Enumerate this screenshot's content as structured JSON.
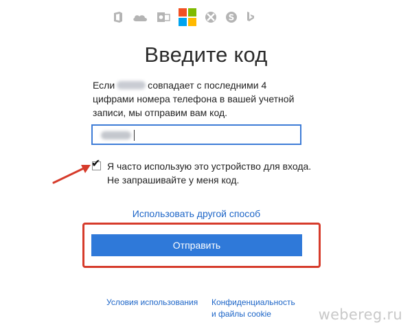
{
  "header": {
    "product_icons": [
      "office-icon",
      "onedrive-icon",
      "outlook-icon",
      "microsoft-logo",
      "xbox-icon",
      "skype-icon",
      "bing-icon"
    ]
  },
  "page": {
    "title": "Введите код",
    "description_part1": "Если",
    "description_part2": "совпадает с последними 4 цифрами номера телефона в вашей учетной записи, мы отправим вам код."
  },
  "remember": {
    "checked": true,
    "label": "Я часто использую это устройство для входа. Не запрашивайте у меня код."
  },
  "links": {
    "alternate": "Использовать другой способ",
    "terms": "Условия использования",
    "privacy": "Конфиденциальность и файлы cookie"
  },
  "buttons": {
    "send": "Отправить"
  },
  "watermark": "webereg.ru",
  "colors": {
    "accent": "#2f79d9",
    "link": "#1b64c7",
    "highlight": "#d63b2b",
    "input_border": "#3d7bd6"
  }
}
